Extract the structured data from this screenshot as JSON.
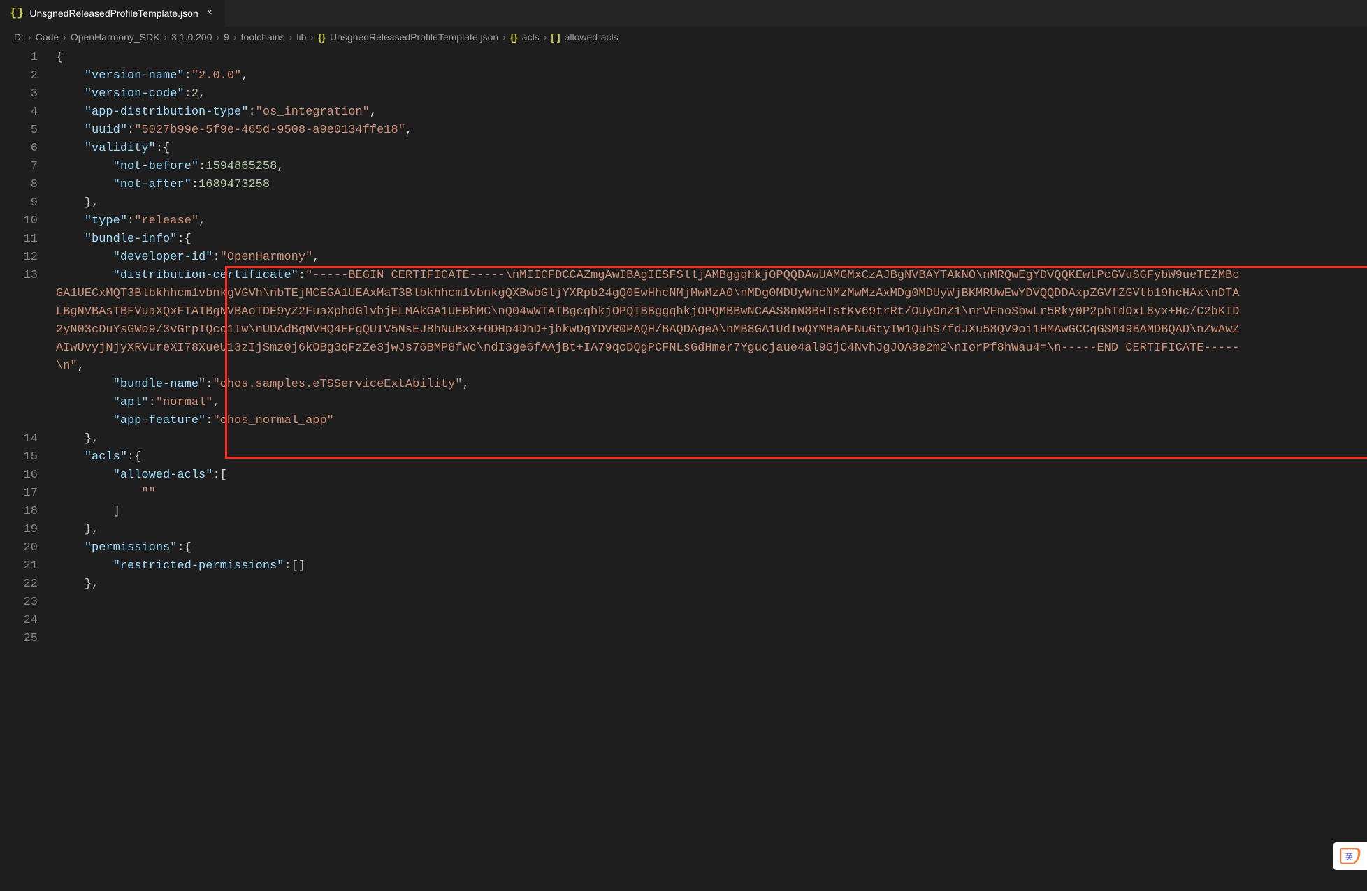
{
  "tab": {
    "icon": "{}",
    "title": "UnsgnedReleasedProfileTemplate.json",
    "close": "×"
  },
  "breadcrumb": {
    "parts": [
      "D:",
      "Code",
      "OpenHarmony_SDK",
      "3.1.0.200",
      "9",
      "toolchains",
      "lib"
    ],
    "fileIcon": "{}",
    "file": "UnsgnedReleasedProfileTemplate.json",
    "sym1Icon": "{}",
    "sym1": "acls",
    "sym2Icon": "[ ]",
    "sym2": "allowed-acls",
    "sep": "›"
  },
  "lines": {
    "l1": "{",
    "l2_key": "\"version-name\"",
    "l2_val": "\"2.0.0\"",
    "l3_key": "\"version-code\"",
    "l3_val": "2",
    "l4_key": "\"app-distribution-type\"",
    "l4_val": "\"os_integration\"",
    "l5_key": "\"uuid\"",
    "l5_val": "\"5027b99e-5f9e-465d-9508-a9e0134ffe18\"",
    "l6_key": "\"validity\"",
    "l7_key": "\"not-before\"",
    "l7_val": "1594865258",
    "l8_key": "\"not-after\"",
    "l8_val": "1689473258",
    "l10_key": "\"type\"",
    "l10_val": "\"release\"",
    "l11_key": "\"bundle-info\"",
    "l12_key": "\"developer-id\"",
    "l12_val": "\"OpenHarmony\"",
    "l13_key": "\"distribution-certificate\"",
    "l13_val": "\"-----BEGIN CERTIFICATE-----\\nMIICFDCCAZmgAwIBAgIESFSlljAMBggqhkjOPQQDAwUAMGMxCzAJBgNVBAYTAkNO\\nMRQwEgYDVQQKEwtPcGVuSGFybW9ueTEZMBcGA1UECxMQT3Blbkhhcm1vbnkgVGVh\\nbTEjMCEGA1UEAxMaT3Blbkhhcm1vbnkgQXBwbGljYXRpb24gQ0EwHhcNMjMwMzA0\\nMDg0MDUyWhcNMzMwMzAxMDg0MDUyWjBKMRUwEwYDVQQDDAxpZGVfZGVtb19hcHAx\\nDTALBgNVBAsTBFVuaXQxFTATBgNVBAoTDE9yZ2FuaXphdGlvbjELMAkGA1UEBhMC\\nQ04wWTATBgcqhkjOPQIBBggqhkjOPQMBBwNCAAS8nN8BHTstKv69trRt/OUyOnZ1\\nrVFnoSbwLr5Rky0P2phTdOxL8yx+Hc/C2bKID2yN03cDuYsGWo9/3vGrpTQco1Iw\\nUDAdBgNVHQ4EFgQUIV5NsEJ8hNuBxX+ODHp4DhD+jbkwDgYDVR0PAQH/BAQDAgeA\\nMB8GA1UdIwQYMBaAFNuGtyIW1QuhS7fdJXu58QV9oi1HMAwGCCqGSM49BAMDBQAD\\nZwAwZAIwUvyjNjyXRVureXI78XueU13zIjSmz0j6kOBg3qFzZe3jwJs76BMP8fWc\\ndI3ge6fAAjBt+IA79qcDQgPCFNLsGdHmer7Ygucjaue4al9GjC4NvhJgJOA8e2m2\\nIorPf8hWau4=\\n-----END CERTIFICATE-----\\n\"",
    "l14_key": "\"bundle-name\"",
    "l14_val": "\"ohos.samples.eTSServiceExtAbility\"",
    "l15_key": "\"apl\"",
    "l15_val": "\"normal\"",
    "l16_key": "\"app-feature\"",
    "l16_val": "\"ohos_normal_app\"",
    "l18_key": "\"acls\"",
    "l19_key": "\"allowed-acls\"",
    "l20_val": "\"\"",
    "l23_key": "\"permissions\"",
    "l24_key": "\"restricted-permissions\""
  },
  "ime": {
    "label": "英"
  }
}
